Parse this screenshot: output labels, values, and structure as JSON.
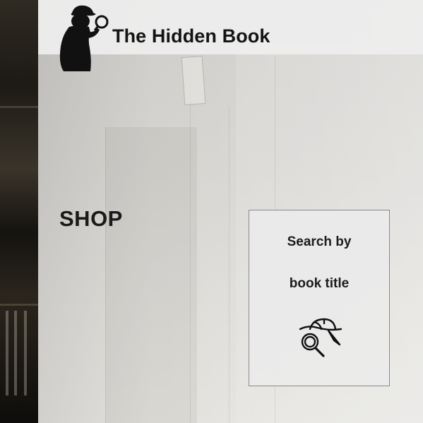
{
  "header": {
    "brand_name": "The Hidden Book",
    "logo_icon": "detective-silhouette-icon"
  },
  "main": {
    "section_title": "SHOP"
  },
  "search_card": {
    "line1": "Search by",
    "line2": "book title",
    "icon": "detective-hat-magnifier-icon"
  },
  "colors": {
    "header_bg": "#eeeeee",
    "card_bg": "#ebebeb",
    "card_border": "#8a8a8a",
    "text": "#141414",
    "left_strip": "#1d1a15"
  }
}
